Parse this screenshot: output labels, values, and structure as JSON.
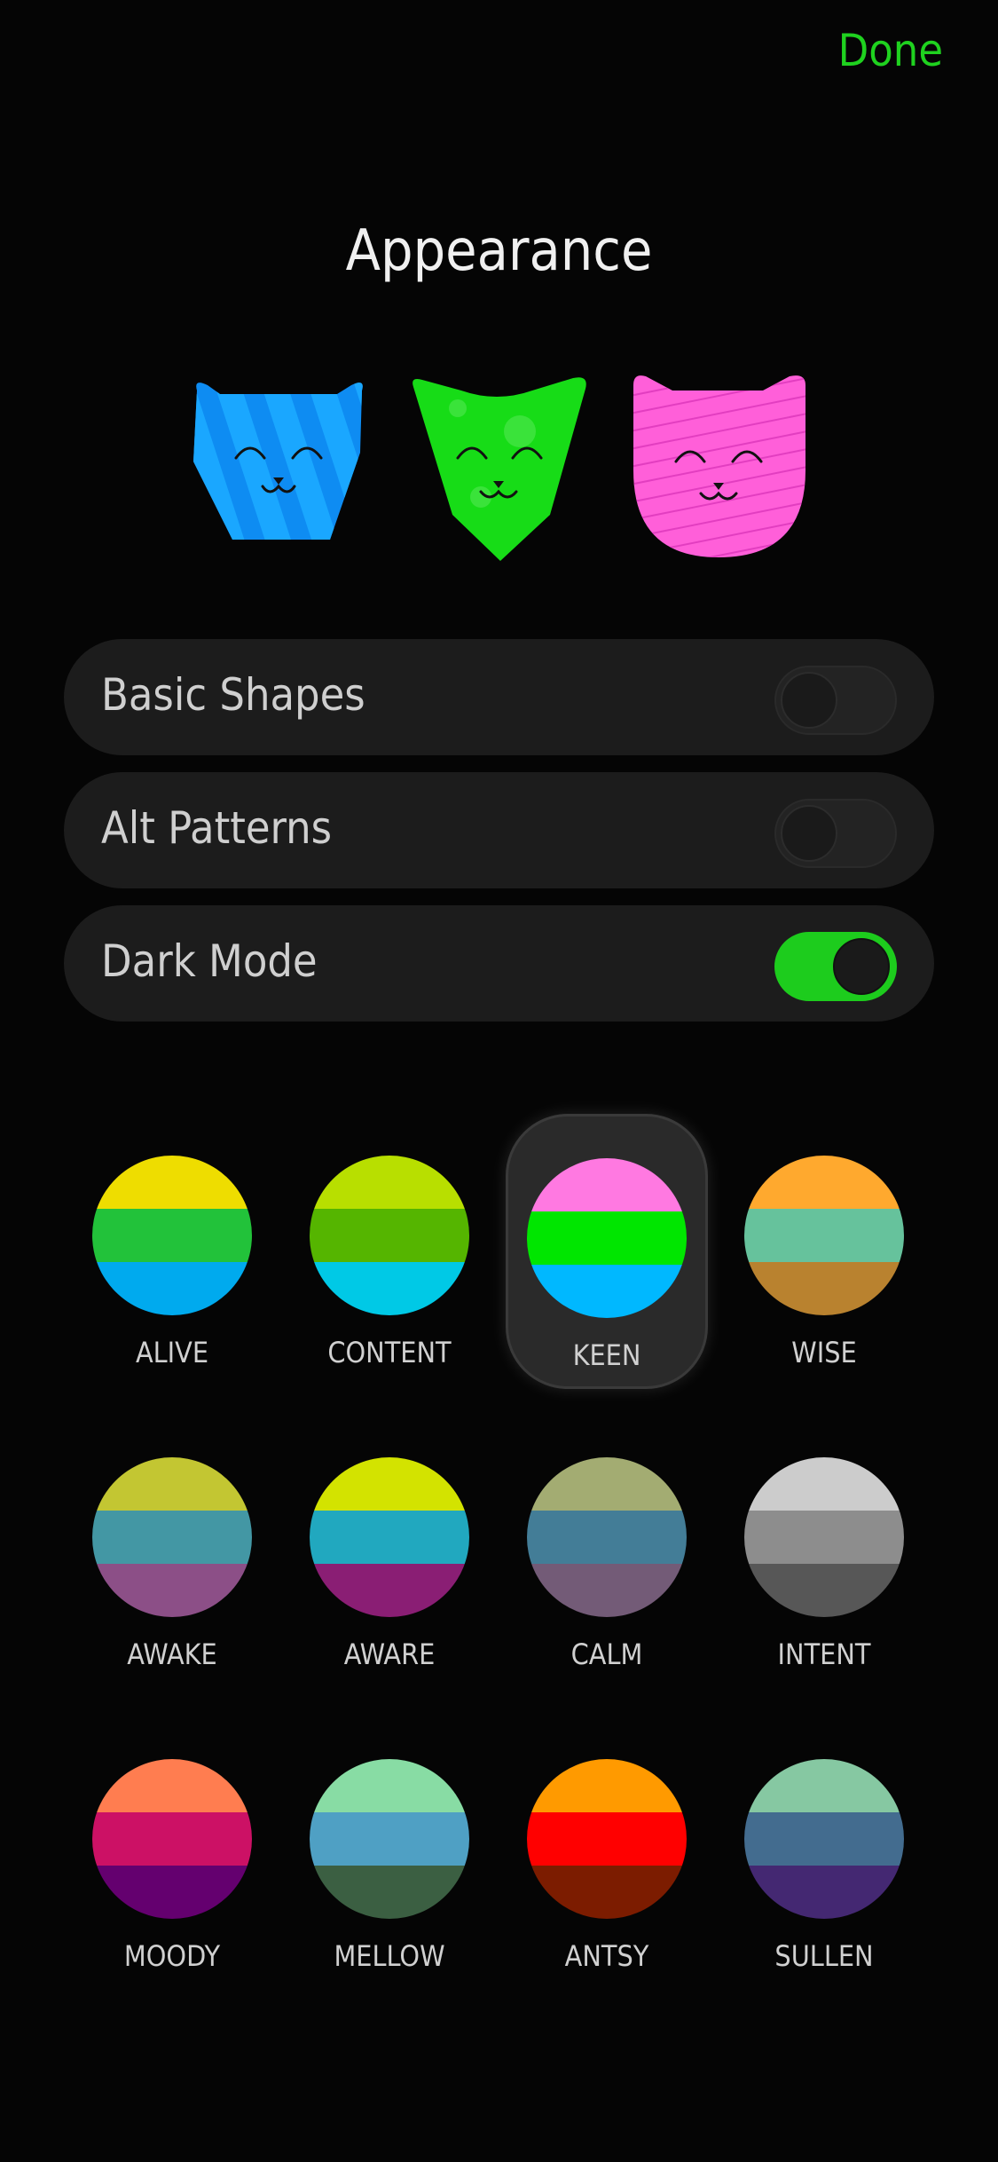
{
  "header": {
    "done_label": "Done",
    "title": "Appearance"
  },
  "cats": [
    {
      "name": "blue-striped-cat",
      "color": "#0e8cf2",
      "stripe": "#1aa7ff"
    },
    {
      "name": "green-spotted-cat",
      "color": "#17dc17",
      "spot": "#3ae33a"
    },
    {
      "name": "pink-lined-cat",
      "color": "#ff5fd9",
      "line": "#e23ec0"
    }
  ],
  "settings": [
    {
      "label": "Basic Shapes",
      "on": false
    },
    {
      "label": "Alt Patterns",
      "on": false
    },
    {
      "label": "Dark Mode",
      "on": true
    }
  ],
  "themes": [
    {
      "label": "ALIVE",
      "colors": [
        "#eedd00",
        "#22c23a",
        "#00aaee"
      ],
      "selected": false
    },
    {
      "label": "CONTENT",
      "colors": [
        "#b8df00",
        "#55b500",
        "#00c9e6"
      ],
      "selected": false
    },
    {
      "label": "KEEN",
      "colors": [
        "#ff79e1",
        "#00e600",
        "#00b8ff"
      ],
      "selected": true
    },
    {
      "label": "WISE",
      "colors": [
        "#ffa92e",
        "#66c29c",
        "#b9822f"
      ],
      "selected": false
    },
    {
      "label": "AWAKE",
      "colors": [
        "#c3c632",
        "#4397a4",
        "#8c4f87"
      ],
      "selected": false
    },
    {
      "label": "AWARE",
      "colors": [
        "#d3e300",
        "#21a8bf",
        "#8a1e74"
      ],
      "selected": false
    },
    {
      "label": "CALM",
      "colors": [
        "#a3ac72",
        "#437d97",
        "#735b77"
      ],
      "selected": false
    },
    {
      "label": "INTENT",
      "colors": [
        "#cccccc",
        "#8d8d8d",
        "#575757"
      ],
      "selected": false
    },
    {
      "label": "MOODY",
      "colors": [
        "#ff7d50",
        "#cc1165",
        "#64006f"
      ],
      "selected": false
    },
    {
      "label": "MELLOW",
      "colors": [
        "#88dca4",
        "#4fa0c4",
        "#3b5f42"
      ],
      "selected": false
    },
    {
      "label": "ANTSY",
      "colors": [
        "#ff9a00",
        "#ff0000",
        "#7c1c00"
      ],
      "selected": false
    },
    {
      "label": "SULLEN",
      "colors": [
        "#86c8a2",
        "#436c8f",
        "#442872"
      ],
      "selected": false
    }
  ]
}
